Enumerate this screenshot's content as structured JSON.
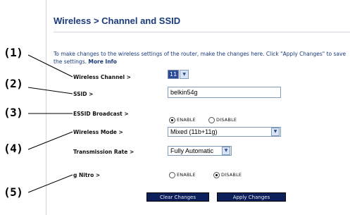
{
  "page": {
    "title": "Wireless > Channel and SSID",
    "intro_text": "To make changes to the wireless settings of the router, make the changes here. Click \"Apply Changes\" to save the settings.",
    "more_info_link": "More Info"
  },
  "callouts": [
    "(1)",
    "(2)",
    "(3)",
    "(4)",
    "(5)"
  ],
  "fields": {
    "channel": {
      "label": "Wireless Channel >",
      "value": "11"
    },
    "ssid": {
      "label": "SSID >",
      "value": "belkin54g"
    },
    "essid_broadcast": {
      "label": "ESSID Broadcast >",
      "enable_label": "ENABLE",
      "disable_label": "DISABLE",
      "selected": "ENABLE"
    },
    "wireless_mode": {
      "label": "Wireless Mode >",
      "value": "Mixed (11b+11g)"
    },
    "transmission_rate": {
      "label": "Transmission Rate >",
      "value": "Fully Automatic"
    },
    "g_nitro": {
      "label": "g Nitro >",
      "enable_label": "ENABLE",
      "disable_label": "DISABLE",
      "selected": "DISABLE"
    }
  },
  "buttons": {
    "clear": "Clear Changes",
    "apply": "Apply Changes"
  },
  "colors": {
    "title": "#1a3a7a",
    "button_bg": "#0d1f5a",
    "selected_option": "#2a4a9a"
  }
}
